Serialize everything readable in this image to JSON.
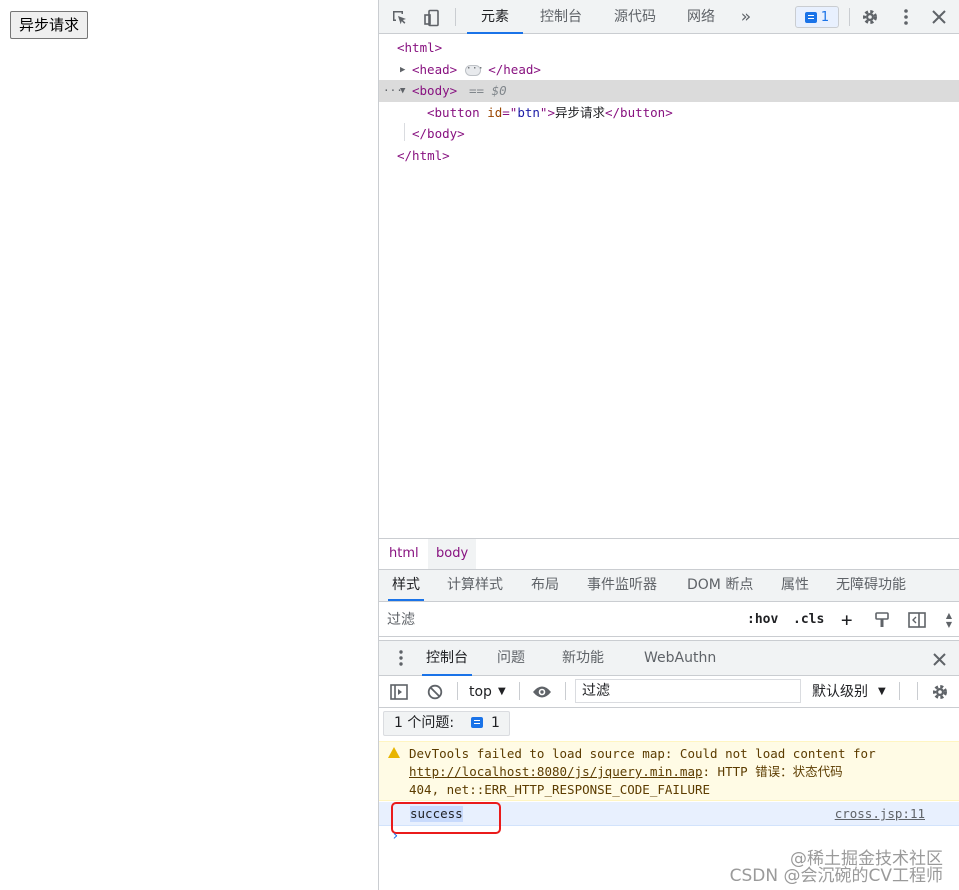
{
  "page": {
    "button_label": "异步请求"
  },
  "devtools": {
    "main_tabs": [
      "元素",
      "控制台",
      "源代码",
      "网络"
    ],
    "more_tabs_glyph": "»",
    "issues_badge_count": "1"
  },
  "dom": {
    "line1": "<html>",
    "line2_open": "<head>",
    "line2_close": "</head>",
    "line3_tag": "<body>",
    "line3_eq": "== $0",
    "line4_open": "<button ",
    "line4_attr_name": "id",
    "line4_eq": "=\"",
    "line4_attr_val": "btn",
    "line4_eq_close": "\">",
    "line4_text": "异步请求",
    "line4_close": "</button>",
    "line5": "</body>",
    "line6": "</html>"
  },
  "breadcrumbs": [
    "html",
    "body"
  ],
  "styles_tabs": [
    "样式",
    "计算样式",
    "布局",
    "事件监听器",
    "DOM 断点",
    "属性",
    "无障碍功能"
  ],
  "styles_filter": {
    "placeholder": "过滤",
    "hov": ":hov",
    "cls": ".cls",
    "plus": "+"
  },
  "drawer_tabs": [
    "控制台",
    "问题",
    "新功能",
    "WebAuthn"
  ],
  "console_toolbar": {
    "context": "top",
    "filter_placeholder": "过滤",
    "levels": "默认级别"
  },
  "issues": {
    "label": "1 个问题:",
    "count": "1"
  },
  "messages": {
    "warning_line1": "DevTools failed to load source map: Could not load content for",
    "warning_link": "http://localhost:8080/js/jquery.min.map",
    "warning_line2_rest": ": HTTP 错误：状态代码",
    "warning_line3": "404, net::ERR_HTTP_RESPONSE_CODE_FAILURE",
    "log_text": "success",
    "log_source": "cross.jsp:11",
    "prompt": "›"
  },
  "watermark": {
    "line1": "@稀土掘金技术社区",
    "line2": "CSDN @会沉碗的CV工程师"
  },
  "colors": {
    "accent": "#1a73e8",
    "highlight_box": "#ea1b1b",
    "warning_bg": "#fffbe5",
    "tag": "#881280"
  }
}
